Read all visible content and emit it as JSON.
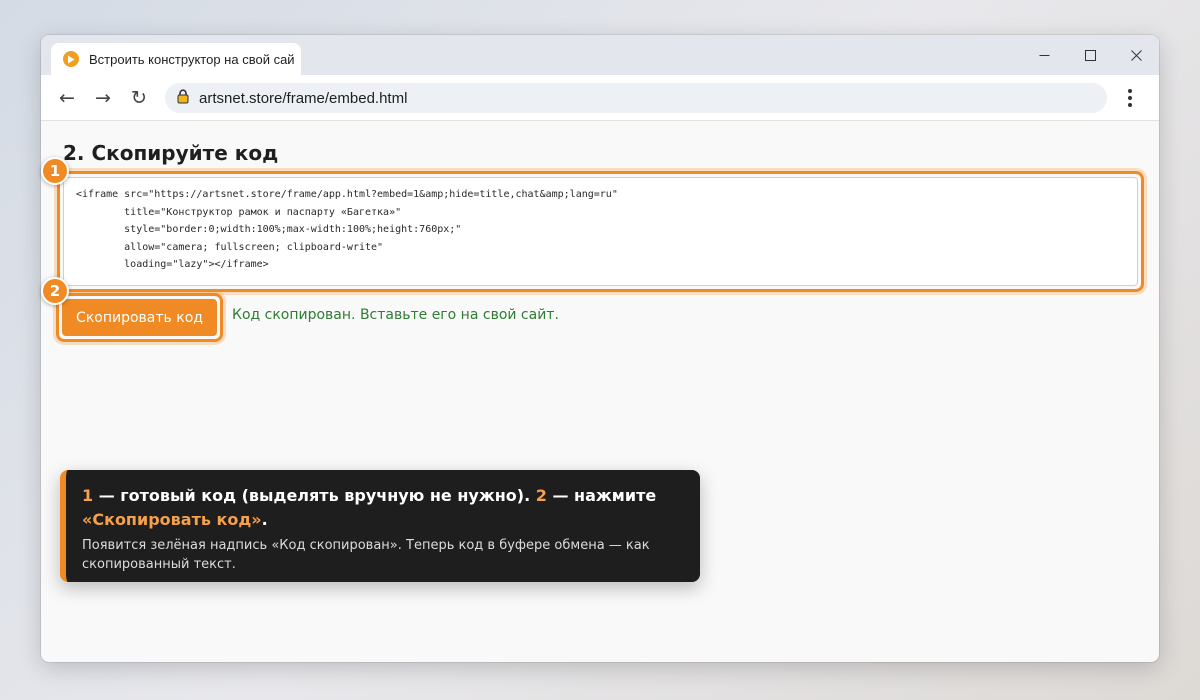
{
  "browser": {
    "tab_title": "Встроить конструктор на свой сай",
    "url": "artsnet.store/frame/embed.html",
    "nav": {
      "back": "←",
      "forward": "→",
      "reload": "↻"
    },
    "icons": [
      "favicon-play-icon",
      "lock-icon",
      "minimize-icon",
      "maximize-icon",
      "close-icon",
      "kebab-menu-icon"
    ]
  },
  "page": {
    "heading": "2. Скопируйте код",
    "code": "<iframe src=\"https://artsnet.store/frame/app.html?embed=1&amp;hide=title,chat&amp;lang=ru\"\n        title=\"Конструктор рамок и паспарту «Багетка»\"\n        style=\"border:0;width:100%;max-width:100%;height:760px;\"\n        allow=\"camera; fullscreen; clipboard-write\"\n        loading=\"lazy\"></iframe>",
    "copy_button": "Скопировать код",
    "status": "Код скопирован. Вставьте его на свой сайт."
  },
  "annotations": {
    "badge_1": "1",
    "badge_2": "2",
    "accent_color": "#f08a24"
  },
  "callout": {
    "num1": "1",
    "text1": " — готовый код (выделять вручную не нужно). ",
    "num2": "2",
    "text2": " — нажмите ",
    "quote": "«Скопировать код»",
    "end": ".",
    "sub": "Появится зелёная надпись «Код скопирован». Теперь код в буфере обмена — как скопированный текст."
  }
}
